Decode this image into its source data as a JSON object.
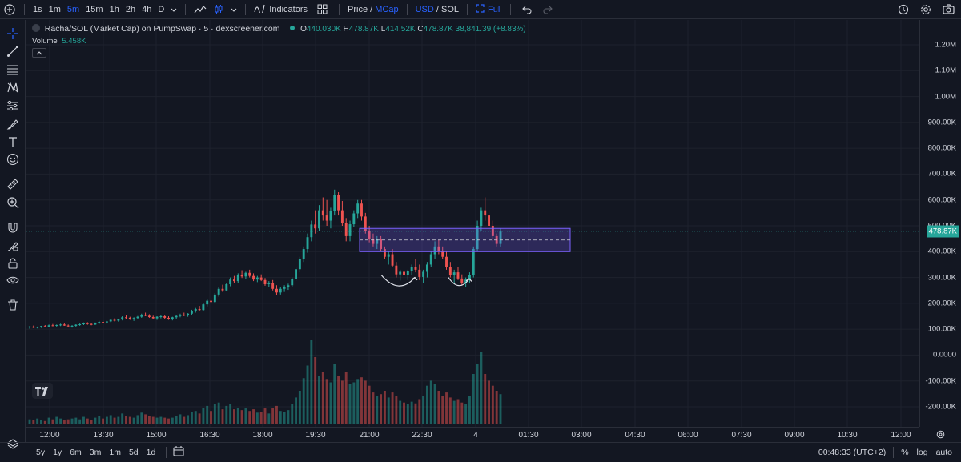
{
  "topbar": {
    "intervals": [
      "1s",
      "1m",
      "5m",
      "15m",
      "1h",
      "2h",
      "4h",
      "D"
    ],
    "active_interval": "5m",
    "indicators_label": "Indicators",
    "price_label": "Price",
    "mcap_label": "MCap",
    "usd_label": "USD",
    "sol_label": "SOL",
    "full_label": "Full",
    "slash": "/"
  },
  "legend": {
    "title": "Racha/SOL (Market Cap) on PumpSwap · 5 · dexscreener.com",
    "open_key": "O",
    "open": "440.030K",
    "high_key": "H",
    "high": "478.87K",
    "low_key": "L",
    "low": "414.52K",
    "close_key": "C",
    "close": "478.87K",
    "change": "38,841.39 (+8.83%)",
    "volume_label": "Volume",
    "volume_value": "5.458K"
  },
  "price_axis": {
    "labels": [
      "1.20M",
      "1.10M",
      "1.00M",
      "900.00K",
      "800.00K",
      "700.00K",
      "600.00K",
      "500.00K",
      "400.00K",
      "300.00K",
      "200.00K",
      "100.00K",
      "0.0000",
      "-100.00K",
      "-200.00K"
    ],
    "last_price": "478.87K"
  },
  "time_axis": {
    "labels": [
      "12:00",
      "13:30",
      "15:00",
      "16:30",
      "18:00",
      "19:30",
      "21:00",
      "22:30",
      "4",
      "01:30",
      "03:00",
      "04:30",
      "06:00",
      "07:30",
      "09:00",
      "10:30",
      "12:00"
    ]
  },
  "bottombar": {
    "ranges": [
      "5y",
      "1y",
      "6m",
      "3m",
      "1m",
      "5d",
      "1d"
    ],
    "clock": "00:48:33 (UTC+2)",
    "percent": "%",
    "log": "log",
    "auto": "auto"
  },
  "colors": {
    "up": "#26a69a",
    "down": "#ef5350",
    "background": "#131722",
    "accent": "#2962ff",
    "zone": "#7b61ff"
  },
  "chart_data": {
    "type": "candlestick",
    "unit": "USD market cap (K)",
    "ylim": [
      -250,
      1250
    ],
    "interval": "5m",
    "candles": [
      [
        107,
        112,
        102,
        110,
        "up",
        6
      ],
      [
        110,
        114,
        104,
        106,
        "down",
        5
      ],
      [
        106,
        110,
        103,
        109,
        "up",
        7
      ],
      [
        109,
        113,
        105,
        112,
        "up",
        5
      ],
      [
        112,
        116,
        107,
        110,
        "down",
        4
      ],
      [
        110,
        118,
        108,
        115,
        "up",
        8
      ],
      [
        115,
        120,
        111,
        113,
        "down",
        6
      ],
      [
        113,
        118,
        110,
        116,
        "up",
        9
      ],
      [
        116,
        121,
        112,
        118,
        "up",
        7
      ],
      [
        118,
        122,
        113,
        114,
        "down",
        5
      ],
      [
        114,
        118,
        108,
        111,
        "down",
        6
      ],
      [
        111,
        116,
        106,
        113,
        "up",
        7
      ],
      [
        113,
        119,
        109,
        117,
        "up",
        8
      ],
      [
        117,
        122,
        113,
        119,
        "up",
        6
      ],
      [
        119,
        126,
        116,
        123,
        "up",
        9
      ],
      [
        123,
        127,
        117,
        120,
        "down",
        7
      ],
      [
        120,
        124,
        115,
        118,
        "down",
        5
      ],
      [
        118,
        126,
        116,
        124,
        "up",
        8
      ],
      [
        124,
        132,
        120,
        128,
        "up",
        10
      ],
      [
        128,
        134,
        122,
        126,
        "down",
        7
      ],
      [
        126,
        133,
        121,
        130,
        "up",
        9
      ],
      [
        130,
        139,
        127,
        136,
        "up",
        11
      ],
      [
        136,
        142,
        130,
        133,
        "down",
        8
      ],
      [
        133,
        140,
        129,
        138,
        "up",
        9
      ],
      [
        138,
        150,
        134,
        146,
        "up",
        13
      ],
      [
        146,
        153,
        140,
        144,
        "down",
        10
      ],
      [
        144,
        148,
        136,
        140,
        "down",
        9
      ],
      [
        140,
        146,
        132,
        143,
        "up",
        8
      ],
      [
        143,
        151,
        139,
        148,
        "up",
        11
      ],
      [
        148,
        160,
        144,
        156,
        "up",
        14
      ],
      [
        156,
        164,
        150,
        152,
        "down",
        12
      ],
      [
        152,
        158,
        144,
        147,
        "down",
        10
      ],
      [
        147,
        152,
        138,
        142,
        "down",
        9
      ],
      [
        142,
        150,
        136,
        148,
        "up",
        8
      ],
      [
        148,
        156,
        142,
        150,
        "up",
        9
      ],
      [
        150,
        154,
        140,
        144,
        "down",
        8
      ],
      [
        144,
        150,
        136,
        140,
        "down",
        7
      ],
      [
        140,
        148,
        134,
        146,
        "up",
        8
      ],
      [
        146,
        154,
        140,
        151,
        "up",
        10
      ],
      [
        151,
        160,
        146,
        156,
        "up",
        12
      ],
      [
        156,
        164,
        150,
        153,
        "down",
        9
      ],
      [
        153,
        162,
        148,
        160,
        "up",
        11
      ],
      [
        160,
        175,
        155,
        170,
        "up",
        15
      ],
      [
        170,
        182,
        164,
        178,
        "up",
        16
      ],
      [
        178,
        190,
        170,
        174,
        "down",
        13
      ],
      [
        174,
        200,
        170,
        196,
        "up",
        20
      ],
      [
        196,
        215,
        188,
        210,
        "up",
        22
      ],
      [
        210,
        222,
        200,
        205,
        "down",
        16
      ],
      [
        205,
        240,
        200,
        234,
        "up",
        24
      ],
      [
        234,
        262,
        226,
        256,
        "up",
        26
      ],
      [
        256,
        272,
        244,
        250,
        "down",
        18
      ],
      [
        250,
        280,
        246,
        274,
        "up",
        22
      ],
      [
        274,
        300,
        266,
        292,
        "up",
        24
      ],
      [
        292,
        306,
        280,
        286,
        "down",
        18
      ],
      [
        286,
        316,
        280,
        310,
        "up",
        20
      ],
      [
        310,
        328,
        298,
        304,
        "down",
        17
      ],
      [
        304,
        322,
        294,
        318,
        "up",
        19
      ],
      [
        318,
        330,
        300,
        306,
        "down",
        16
      ],
      [
        306,
        316,
        286,
        292,
        "down",
        18
      ],
      [
        292,
        306,
        282,
        300,
        "up",
        14
      ],
      [
        300,
        312,
        286,
        290,
        "down",
        15
      ],
      [
        290,
        298,
        268,
        274,
        "down",
        19
      ],
      [
        274,
        286,
        262,
        280,
        "up",
        13
      ],
      [
        280,
        290,
        250,
        256,
        "down",
        20
      ],
      [
        256,
        270,
        232,
        242,
        "down",
        22
      ],
      [
        242,
        262,
        234,
        256,
        "up",
        16
      ],
      [
        256,
        270,
        244,
        262,
        "up",
        15
      ],
      [
        262,
        276,
        252,
        270,
        "up",
        17
      ],
      [
        270,
        300,
        262,
        294,
        "up",
        24
      ],
      [
        294,
        340,
        286,
        332,
        "up",
        32
      ],
      [
        332,
        380,
        320,
        372,
        "up",
        40
      ],
      [
        372,
        420,
        360,
        410,
        "up",
        55
      ],
      [
        410,
        470,
        396,
        456,
        "up",
        70
      ],
      [
        456,
        520,
        440,
        505,
        "up",
        100
      ],
      [
        505,
        560,
        470,
        490,
        "down",
        80
      ],
      [
        490,
        580,
        480,
        560,
        "up",
        58
      ],
      [
        560,
        610,
        520,
        540,
        "down",
        62
      ],
      [
        540,
        600,
        500,
        520,
        "down",
        54
      ],
      [
        520,
        570,
        490,
        556,
        "up",
        50
      ],
      [
        556,
        640,
        540,
        620,
        "up",
        72
      ],
      [
        620,
        630,
        540,
        560,
        "down",
        58
      ],
      [
        560,
        596,
        500,
        510,
        "down",
        52
      ],
      [
        510,
        530,
        440,
        460,
        "down",
        62
      ],
      [
        460,
        520,
        440,
        506,
        "up",
        48
      ],
      [
        506,
        560,
        496,
        548,
        "up",
        50
      ],
      [
        548,
        600,
        530,
        586,
        "up",
        54
      ],
      [
        586,
        600,
        520,
        536,
        "down",
        56
      ],
      [
        536,
        550,
        470,
        480,
        "down",
        52
      ],
      [
        480,
        500,
        436,
        450,
        "down",
        46
      ],
      [
        450,
        470,
        420,
        430,
        "down",
        38
      ],
      [
        430,
        460,
        410,
        448,
        "up",
        34
      ],
      [
        448,
        460,
        400,
        410,
        "down",
        36
      ],
      [
        410,
        420,
        370,
        380,
        "down",
        40
      ],
      [
        380,
        400,
        350,
        390,
        "up",
        32
      ],
      [
        390,
        410,
        340,
        346,
        "down",
        38
      ],
      [
        346,
        360,
        300,
        312,
        "down",
        34
      ],
      [
        312,
        330,
        288,
        322,
        "up",
        28
      ],
      [
        322,
        340,
        300,
        308,
        "down",
        26
      ],
      [
        308,
        330,
        290,
        326,
        "up",
        24
      ],
      [
        326,
        350,
        310,
        340,
        "up",
        27
      ],
      [
        340,
        370,
        320,
        330,
        "down",
        25
      ],
      [
        330,
        350,
        290,
        302,
        "down",
        30
      ],
      [
        302,
        330,
        280,
        322,
        "up",
        34
      ],
      [
        322,
        360,
        300,
        350,
        "up",
        46
      ],
      [
        350,
        400,
        340,
        390,
        "up",
        52
      ],
      [
        390,
        440,
        370,
        420,
        "up",
        48
      ],
      [
        420,
        446,
        390,
        400,
        "down",
        40
      ],
      [
        400,
        420,
        370,
        380,
        "down",
        34
      ],
      [
        380,
        400,
        330,
        340,
        "down",
        38
      ],
      [
        340,
        360,
        300,
        310,
        "down",
        32
      ],
      [
        310,
        330,
        280,
        320,
        "up",
        28
      ],
      [
        320,
        340,
        290,
        296,
        "down",
        30
      ],
      [
        296,
        312,
        270,
        280,
        "down",
        26
      ],
      [
        280,
        300,
        264,
        292,
        "up",
        24
      ],
      [
        292,
        320,
        280,
        310,
        "up",
        34
      ],
      [
        310,
        420,
        300,
        410,
        "up",
        60
      ],
      [
        410,
        520,
        400,
        500,
        "up",
        72
      ],
      [
        500,
        570,
        480,
        560,
        "up",
        86
      ],
      [
        560,
        610,
        520,
        540,
        "down",
        60
      ],
      [
        540,
        560,
        480,
        500,
        "down",
        52
      ],
      [
        500,
        520,
        440,
        460,
        "down",
        46
      ],
      [
        460,
        470,
        420,
        430,
        "down",
        40
      ],
      [
        430,
        490,
        420,
        478,
        "up",
        36
      ]
    ]
  }
}
